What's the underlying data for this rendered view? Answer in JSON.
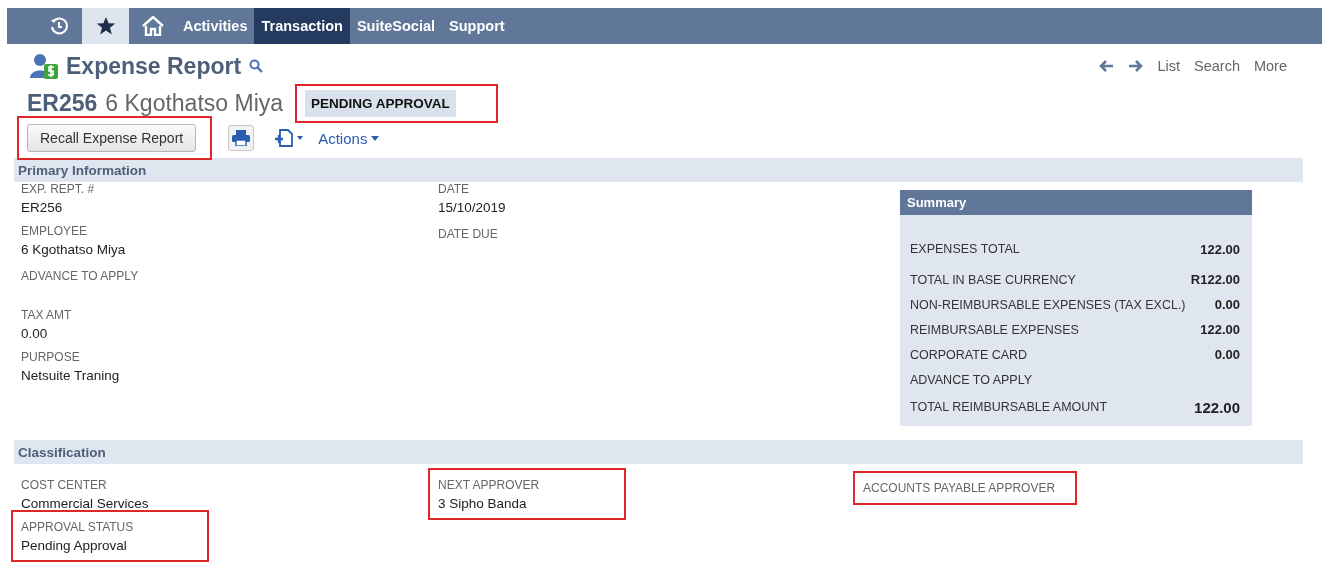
{
  "nav": {
    "icon_tabs": [
      {
        "selected": false
      },
      {
        "selected": true
      },
      {
        "selected": false
      }
    ],
    "tabs": [
      {
        "label": "Activities",
        "selected": false
      },
      {
        "label": "Transaction",
        "selected": true
      },
      {
        "label": "SuiteSocial",
        "selected": false
      },
      {
        "label": "Support",
        "selected": false
      }
    ]
  },
  "header": {
    "title": "Expense Report",
    "links": [
      "List",
      "Search",
      "More"
    ]
  },
  "record": {
    "number": "ER256",
    "name": "6 Kgothatso Miya",
    "status": {
      "label": "PENDING APPROVAL",
      "annotated": true
    }
  },
  "toolbar": {
    "recall_button": {
      "label": "Recall Expense Report",
      "annotated": true
    },
    "actions": "Actions"
  },
  "primary": {
    "title": "Primary Information",
    "columns": [
      [
        {
          "label": "EXP. REPT. #",
          "value": "ER256",
          "annotated": false
        },
        {
          "label": "EMPLOYEE",
          "value": "6 Kgothatso Miya",
          "annotated": false
        },
        {
          "label": "ADVANCE TO APPLY",
          "annotated": false
        },
        {
          "label": "TAX AMT",
          "value": "0.00",
          "annotated": false
        },
        {
          "label": "PURPOSE",
          "value": "Netsuite Traning",
          "annotated": false
        }
      ],
      [
        {
          "label": "DATE",
          "value": "15/10/2019",
          "annotated": false
        },
        {
          "label": "DATE DUE",
          "annotated": false
        }
      ]
    ]
  },
  "summary": {
    "title": "Summary",
    "rows": [
      {
        "label": "EXPENSES TOTAL",
        "value": "122.00",
        "emphasis": false
      },
      {
        "label": "TOTAL IN BASE CURRENCY",
        "value": "R122.00",
        "emphasis": false
      },
      {
        "label": "NON-REIMBURSABLE EXPENSES (TAX EXCL.)",
        "value": "0.00",
        "emphasis": false
      },
      {
        "label": "REIMBURSABLE EXPENSES",
        "value": "122.00",
        "emphasis": false
      },
      {
        "label": "CORPORATE CARD",
        "value": "0.00",
        "emphasis": false
      },
      {
        "label": "ADVANCE TO APPLY"
      },
      {
        "label": "TOTAL REIMBURSABLE AMOUNT",
        "value": "122.00",
        "emphasis": true
      }
    ]
  },
  "classification": {
    "title": "Classification",
    "columns": [
      [
        {
          "label": "COST CENTER",
          "value": "Commercial Services",
          "annotated": false
        },
        {
          "label": "APPROVAL STATUS",
          "value": "Pending Approval",
          "annotated": true
        }
      ],
      [
        {
          "label": "NEXT APPROVER",
          "value": "3 Sipho Banda",
          "annotated": true
        }
      ],
      [
        {
          "label": "ACCOUNTS PAYABLE APPROVER",
          "annotated": true
        }
      ]
    ]
  }
}
